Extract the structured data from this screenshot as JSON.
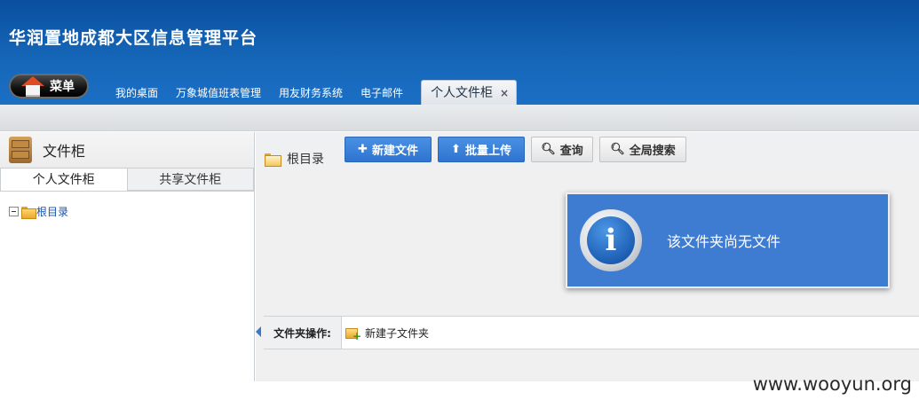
{
  "header": {
    "app_title": "华润置地成都大区信息管理平台",
    "menu_label": "菜单",
    "nav_items": [
      "我的桌面",
      "万象城值班表管理",
      "用友财务系统",
      "电子邮件"
    ],
    "active_tab": "个人文件柜",
    "close_symbol": "×"
  },
  "left_panel": {
    "title": "文件柜",
    "tabs": [
      "个人文件柜",
      "共享文件柜"
    ],
    "tree_root": "根目录"
  },
  "right_panel": {
    "breadcrumb": "根目录",
    "buttons": {
      "new_file": "新建文件",
      "batch_upload": "批量上传",
      "query": "查询",
      "global_search": "全局搜索"
    },
    "message": "该文件夹尚无文件",
    "folder_ops_label": "文件夹操作:",
    "new_subfolder": "新建子文件夹"
  },
  "watermark": "www.wooyun.org",
  "colors": {
    "header_blue": "#1566b8",
    "button_blue": "#2f74d0",
    "message_blue": "#3d7cd0",
    "tree_link": "#1a52a8"
  }
}
